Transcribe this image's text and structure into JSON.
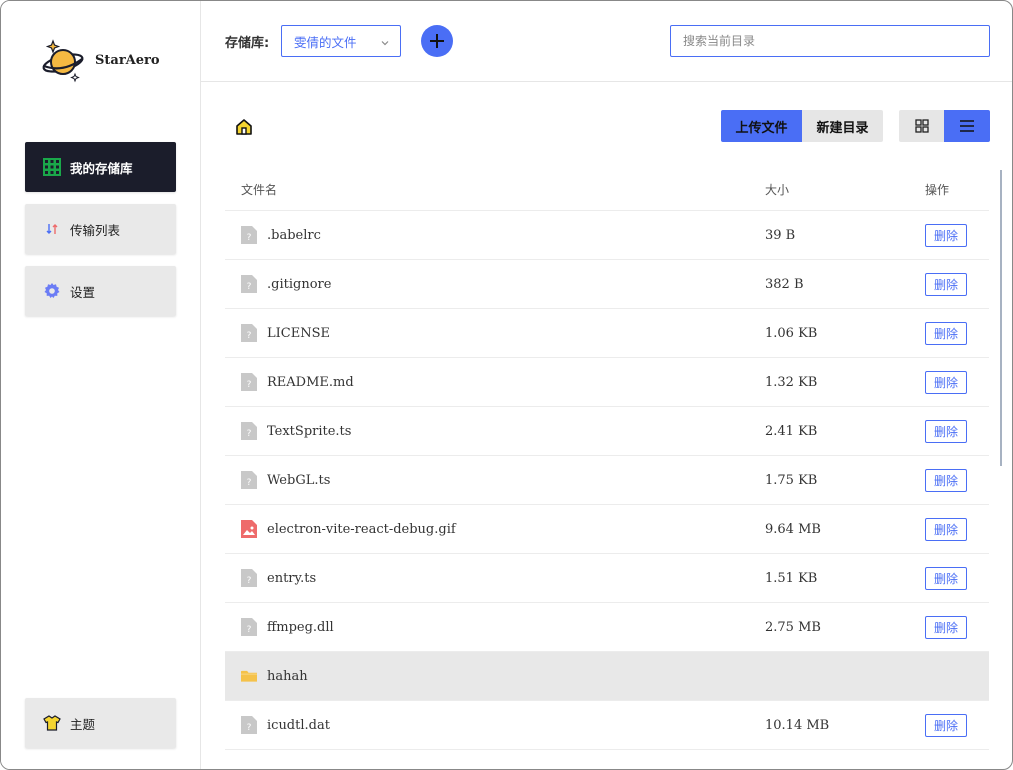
{
  "app": {
    "name": "StarAero"
  },
  "sidebar": {
    "items": [
      {
        "label": "我的存储库",
        "icon": "grid-storage-icon",
        "active": true
      },
      {
        "label": "传输列表",
        "icon": "transfer-arrows-icon",
        "active": false
      },
      {
        "label": "设置",
        "icon": "gear-icon",
        "active": false
      }
    ],
    "theme": {
      "label": "主题",
      "icon": "tshirt-icon"
    }
  },
  "topbar": {
    "repo_label": "存储库:",
    "repo_selected": "雯倩的文件",
    "search_placeholder": "搜索当前目录"
  },
  "toolbar": {
    "upload_label": "上传文件",
    "newdir_label": "新建目录"
  },
  "table": {
    "headers": {
      "name": "文件名",
      "size": "大小",
      "op": "操作"
    },
    "rows": [
      {
        "name": ".babelrc",
        "size": "39 B",
        "type": "file",
        "action": "删除"
      },
      {
        "name": ".gitignore",
        "size": "382 B",
        "type": "file",
        "action": "删除"
      },
      {
        "name": "LICENSE",
        "size": "1.06 KB",
        "type": "file",
        "action": "删除"
      },
      {
        "name": "README.md",
        "size": "1.32 KB",
        "type": "file",
        "action": "删除"
      },
      {
        "name": "TextSprite.ts",
        "size": "2.41 KB",
        "type": "file",
        "action": "删除"
      },
      {
        "name": "WebGL.ts",
        "size": "1.75 KB",
        "type": "file",
        "action": "删除"
      },
      {
        "name": "electron-vite-react-debug.gif",
        "size": "9.64 MB",
        "type": "image",
        "action": "删除"
      },
      {
        "name": "entry.ts",
        "size": "1.51 KB",
        "type": "file",
        "action": "删除"
      },
      {
        "name": "ffmpeg.dll",
        "size": "2.75 MB",
        "type": "file",
        "action": "删除"
      },
      {
        "name": "hahah",
        "size": "",
        "type": "folder",
        "action": ""
      },
      {
        "name": "icudtl.dat",
        "size": "10.14 MB",
        "type": "file",
        "action": "删除"
      }
    ]
  },
  "colors": {
    "accent": "#4a6ef5",
    "sidebar_active": "#1b1d2b",
    "folder": "#f5c24a",
    "image_icon": "#ee6b6b"
  }
}
